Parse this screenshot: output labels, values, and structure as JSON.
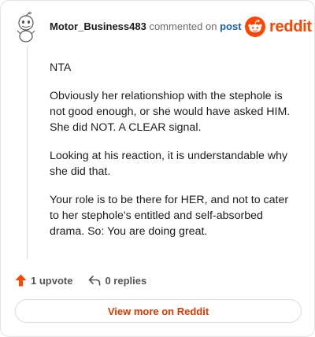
{
  "comment": {
    "username": "Motor_Business483",
    "action_text": "commented on",
    "post_link": "post",
    "paragraphs": [
      "NTA",
      "Obviously her relationshiop with the stephole is not good enough, or she would have asked HIM. She did NOT. A CLEAR signal.",
      "Looking at his reaction, it is understandable why she did that.",
      "Your role is to be there for HER, and not to cater to her stephole's entitled and self-absorbed drama. So: You are doing great."
    ]
  },
  "brand": {
    "logo_text": "reddit",
    "color": "#ff4500"
  },
  "actions": {
    "upvotes_label": "1 upvote",
    "replies_label": "0 replies"
  },
  "footer": {
    "view_more_label": "View more on Reddit"
  },
  "colors": {
    "link": "#1c5fa8",
    "button_text": "#d93a00",
    "upvote": "#ff4500"
  }
}
